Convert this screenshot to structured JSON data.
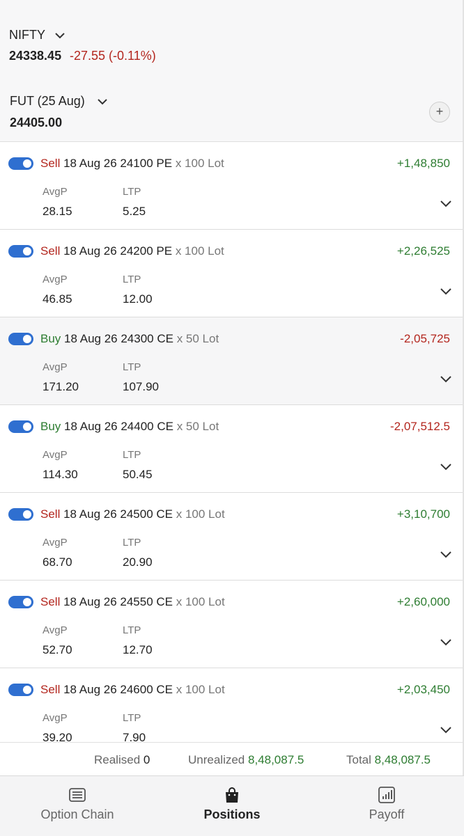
{
  "index": {
    "name": "NIFTY",
    "price": "24338.45",
    "change": "-27.55 (-0.11%)"
  },
  "futures": {
    "name": "FUT (25 Aug)",
    "price": "24405.00",
    "add_label": "+"
  },
  "positions": [
    {
      "side": "Sell",
      "contract": "18 Aug 26 24100 PE",
      "lots": "x 100 Lot",
      "pnl": "+1,48,850",
      "avgp_label": "AvgP",
      "avgp": "28.15",
      "ltp_label": "LTP",
      "ltp": "5.25",
      "enabled": true
    },
    {
      "side": "Sell",
      "contract": "18 Aug 26 24200 PE",
      "lots": "x 100 Lot",
      "pnl": "+2,26,525",
      "avgp_label": "AvgP",
      "avgp": "46.85",
      "ltp_label": "LTP",
      "ltp": "12.00",
      "enabled": true
    },
    {
      "side": "Buy",
      "contract": "18 Aug 26 24300 CE",
      "lots": "x 50 Lot",
      "pnl": "-2,05,725",
      "avgp_label": "AvgP",
      "avgp": "171.20",
      "ltp_label": "LTP",
      "ltp": "107.90",
      "enabled": true
    },
    {
      "side": "Buy",
      "contract": "18 Aug 26 24400 CE",
      "lots": "x 50 Lot",
      "pnl": "-2,07,512.5",
      "avgp_label": "AvgP",
      "avgp": "114.30",
      "ltp_label": "LTP",
      "ltp": "50.45",
      "enabled": true
    },
    {
      "side": "Sell",
      "contract": "18 Aug 26 24500 CE",
      "lots": "x 100 Lot",
      "pnl": "+3,10,700",
      "avgp_label": "AvgP",
      "avgp": "68.70",
      "ltp_label": "LTP",
      "ltp": "20.90",
      "enabled": true
    },
    {
      "side": "Sell",
      "contract": "18 Aug 26 24550 CE",
      "lots": "x 100 Lot",
      "pnl": "+2,60,000",
      "avgp_label": "AvgP",
      "avgp": "52.70",
      "ltp_label": "LTP",
      "ltp": "12.70",
      "enabled": true
    },
    {
      "side": "Sell",
      "contract": "18 Aug 26 24600 CE",
      "lots": "x 100 Lot",
      "pnl": "+2,03,450",
      "avgp_label": "AvgP",
      "avgp": "39.20",
      "ltp_label": "LTP",
      "ltp": "7.90",
      "enabled": true
    }
  ],
  "summary": {
    "realised_label": "Realised",
    "realised_value": "0",
    "unrealized_label": "Unrealized",
    "unrealized_value": "8,48,087.5",
    "total_label": "Total",
    "total_value": "8,48,087.5"
  },
  "nav": {
    "items": [
      {
        "label": "Option Chain",
        "icon": "option-chain-icon",
        "active": false
      },
      {
        "label": "Positions",
        "icon": "shopping-bag-icon",
        "active": true
      },
      {
        "label": "Payoff",
        "icon": "bar-chart-icon",
        "active": false
      }
    ]
  },
  "colors": {
    "sell": "#b3261e",
    "buy": "#2e7d32",
    "profit": "#2e7d32",
    "loss": "#b3261e",
    "toggle": "#2f6fd0",
    "highlight_row": "#f6f6f7"
  }
}
